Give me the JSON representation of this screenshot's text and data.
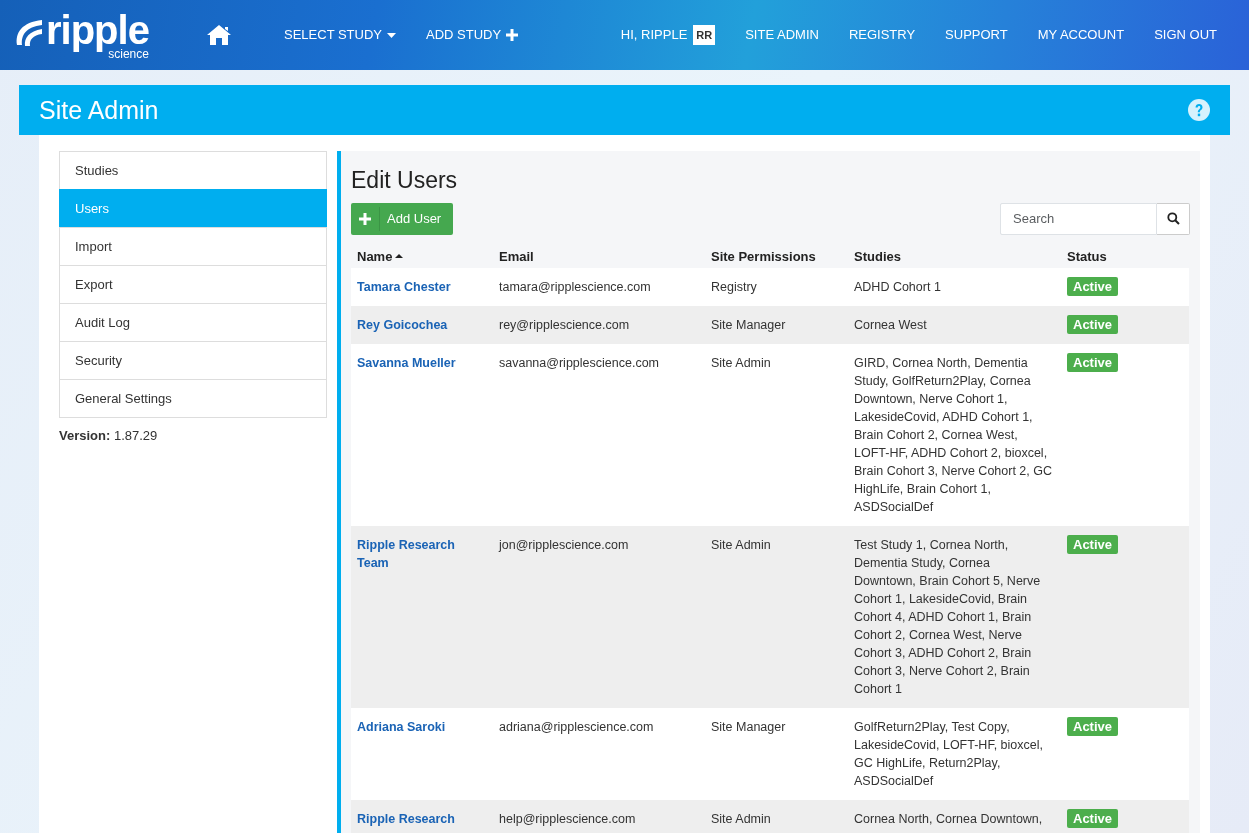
{
  "navbar": {
    "logo": {
      "word": "ripple",
      "sub": "science"
    },
    "left_links": [
      {
        "label": "SELECT STUDY",
        "kind": "dropdown"
      },
      {
        "label": "ADD STUDY",
        "kind": "add"
      }
    ],
    "greeting": "HI, RIPPLE",
    "initials": "RR",
    "right_links": [
      "SITE ADMIN",
      "REGISTRY",
      "SUPPORT",
      "MY ACCOUNT",
      "SIGN OUT"
    ]
  },
  "header": {
    "title": "Site Admin"
  },
  "sidebar": {
    "items": [
      {
        "label": "Studies",
        "selected": false
      },
      {
        "label": "Users",
        "selected": true
      },
      {
        "label": "Import",
        "selected": false
      },
      {
        "label": "Export",
        "selected": false
      },
      {
        "label": "Audit Log",
        "selected": false
      },
      {
        "label": "Security",
        "selected": false
      },
      {
        "label": "General Settings",
        "selected": false
      }
    ],
    "version_label": "Version:",
    "version": "1.87.29"
  },
  "main": {
    "title": "Edit Users",
    "add_button": "Add User",
    "search": {
      "placeholder": "Search"
    },
    "table": {
      "columns": [
        {
          "label": "Name",
          "sorted": true
        },
        {
          "label": "Email",
          "sorted": false
        },
        {
          "label": "Site Permissions",
          "sorted": false
        },
        {
          "label": "Studies",
          "sorted": false
        },
        {
          "label": "Status",
          "sorted": false
        }
      ],
      "rows": [
        {
          "name": "Tamara Chester",
          "email": "tamara@ripplescience.com",
          "permissions": "Registry",
          "studies": "ADHD Cohort 1",
          "status": "Active"
        },
        {
          "name": "Rey Goicochea",
          "email": "rey@ripplescience.com",
          "permissions": "Site Manager",
          "studies": "Cornea West",
          "status": "Active"
        },
        {
          "name": "Savanna Mueller",
          "email": "savanna@ripplescience.com",
          "permissions": "Site Admin",
          "studies": "GIRD, Cornea North, Dementia Study, GolfReturn2Play, Cornea Downtown, Nerve Cohort 1, LakesideCovid, ADHD Cohort 1, Brain Cohort 2, Cornea West, LOFT-HF, ADHD Cohort 2, bioxcel, Brain Cohort 3, Nerve Cohort 2, GC HighLife, Brain Cohort 1, ASDSocialDef",
          "status": "Active"
        },
        {
          "name": "Ripple Research Team",
          "email": "jon@ripplescience.com",
          "permissions": "Site Admin",
          "studies": "Test Study 1, Cornea North, Dementia Study, Cornea Downtown, Brain Cohort 5, Nerve Cohort 1, LakesideCovid, Brain Cohort 4, ADHD Cohort 1, Brain Cohort 2, Cornea West, Nerve Cohort 3, ADHD Cohort 2, Brain Cohort 3, Nerve Cohort 2, Brain Cohort 1",
          "status": "Active"
        },
        {
          "name": "Adriana Saroki",
          "email": "adriana@ripplescience.com",
          "permissions": "Site Manager",
          "studies": "GolfReturn2Play, Test Copy, LakesideCovid, LOFT-HF, bioxcel, GC HighLife, Return2Play, ASDSocialDef",
          "status": "Active"
        },
        {
          "name": "Ripple Research",
          "email": "help@ripplescience.com",
          "permissions": "Site Admin",
          "studies": "Cornea North, Cornea Downtown,",
          "status": "Active"
        }
      ]
    }
  }
}
